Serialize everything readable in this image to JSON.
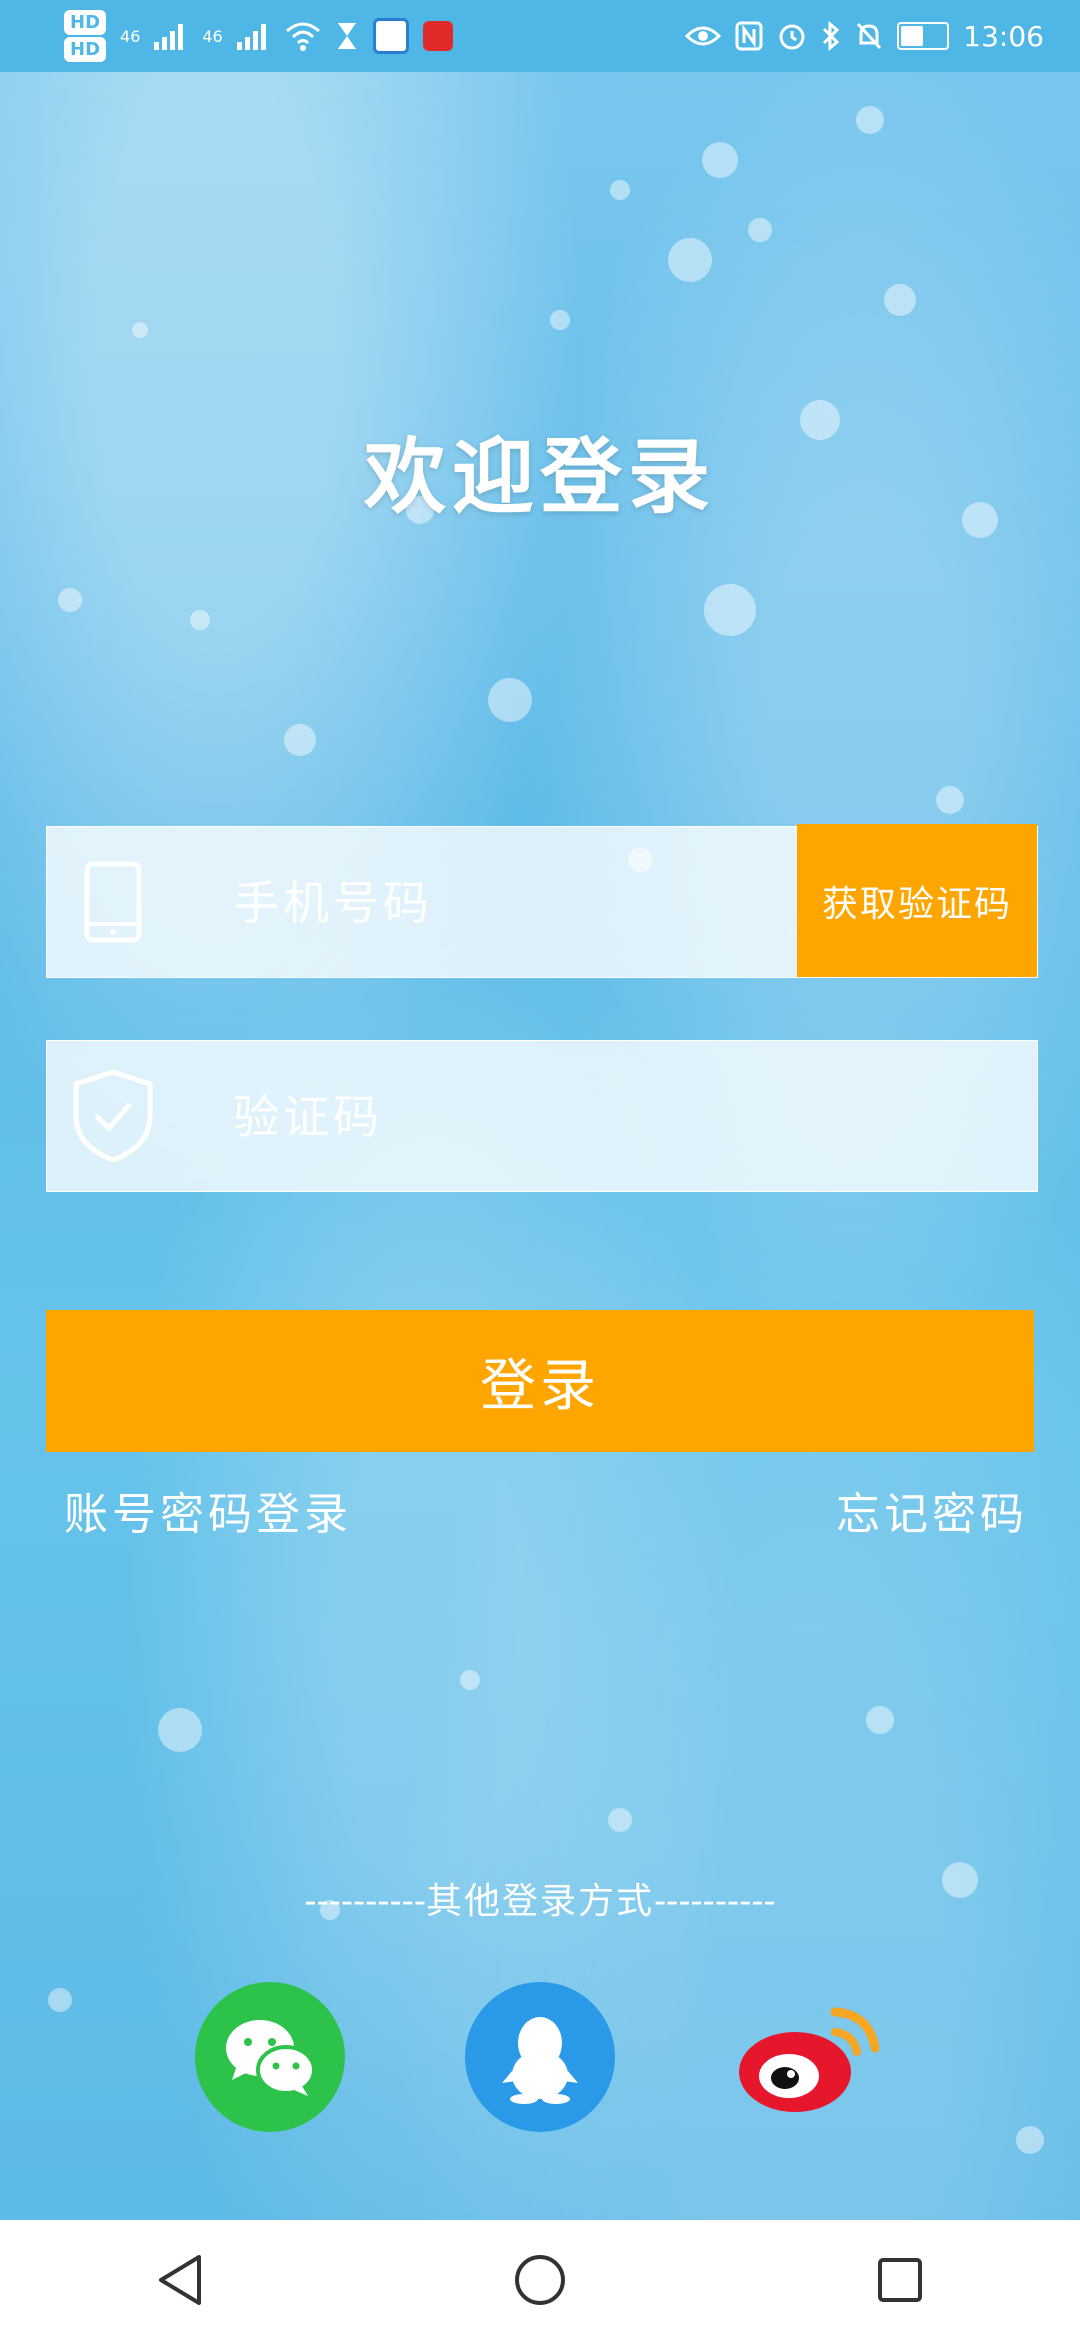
{
  "status_bar": {
    "hd1": "HD",
    "hd2": "HD",
    "net1": "46",
    "net2": "46",
    "time": "13:06"
  },
  "title": "欢迎登录",
  "phone_field": {
    "placeholder": "手机号码",
    "icon": "phone-icon",
    "code_button_label": "获取验证码"
  },
  "code_field": {
    "placeholder": "验证码",
    "icon": "shield-check-icon"
  },
  "login_button_label": "登录",
  "links": {
    "account_password_login": "账号密码登录",
    "forgot_password": "忘记密码"
  },
  "other_login": {
    "label": "其他登录方式",
    "dashes": "----------",
    "providers": [
      {
        "name": "wechat",
        "icon": "wechat-icon",
        "color": "#2dc24a"
      },
      {
        "name": "qq",
        "icon": "qq-icon",
        "color": "#2a9ae8"
      },
      {
        "name": "weibo",
        "icon": "weibo-icon",
        "color": "#e6162d"
      }
    ]
  },
  "colors": {
    "accent": "#ffa500",
    "status_bar": "#4fb7e5"
  }
}
